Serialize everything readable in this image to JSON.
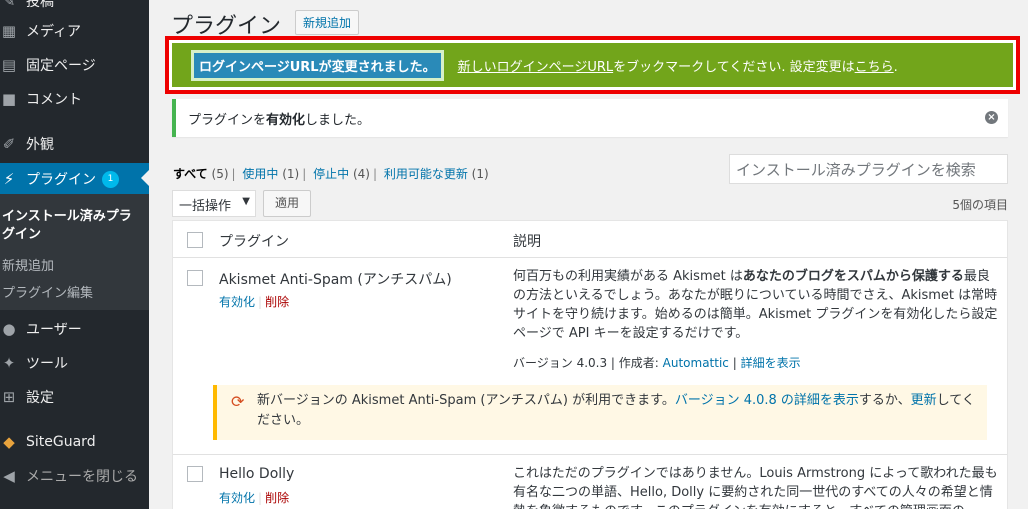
{
  "sidebar": {
    "items": [
      {
        "label": "投稿",
        "icon": "pin-icon"
      },
      {
        "label": "メディア",
        "icon": "media-icon"
      },
      {
        "label": "固定ページ",
        "icon": "page-icon"
      },
      {
        "label": "コメント",
        "icon": "comment-icon"
      },
      {
        "label": "外観",
        "icon": "brush-icon"
      },
      {
        "label": "プラグイン",
        "icon": "plug-icon",
        "badge": "1"
      },
      {
        "label": "ユーザー",
        "icon": "user-icon"
      },
      {
        "label": "ツール",
        "icon": "wrench-icon"
      },
      {
        "label": "設定",
        "icon": "settings-icon"
      },
      {
        "label": "SiteGuard",
        "icon": "siteguard-icon"
      },
      {
        "label": "メニューを閉じる",
        "icon": "collapse-icon"
      }
    ],
    "submenu": {
      "current": "インストール済みプラグイン",
      "items": [
        "新規追加",
        "プラグイン編集"
      ]
    }
  },
  "header": {
    "title": "プラグイン",
    "add_new": "新規追加"
  },
  "notice_url": {
    "button": "ログインページURLが変更されました。",
    "text_link1": "新しいログインページURL",
    "text_mid": "をブックマークしてください. 設定変更は",
    "text_link2": "こちら",
    "text_end": "."
  },
  "notice_activated": {
    "pre": "プラグインを",
    "bold": "有効化",
    "post": "しました。"
  },
  "filters": {
    "all": "すべて",
    "all_count": "(5)",
    "active": "使用中",
    "active_count": "(1)",
    "inactive": "停止中",
    "inactive_count": "(4)",
    "update": "利用可能な更新",
    "update_count": "(1)"
  },
  "search": {
    "placeholder": "インストール済みプラグインを検索"
  },
  "bulk": {
    "label": "一括操作",
    "apply": "適用",
    "item_count": "5個の項目"
  },
  "table": {
    "col_plugin": "プラグイン",
    "col_desc": "説明",
    "rows": [
      {
        "name": "Akismet Anti-Spam (アンチスパム)",
        "activate": "有効化",
        "delete": "削除",
        "desc_pre": "何百万もの利用実績がある Akismet は",
        "desc_bold": "あなたのブログをスパムから保護する",
        "desc_post": "最良の方法といえるでしょう。あなたが眠りについている時間でさえ、Akismet は常時サイトを守り続けます。始めるのは簡単。Akismet プラグインを有効化したら設定ページで API キーを設定するだけです。",
        "version": "バージョン 4.0.3",
        "author_label": "作成者:",
        "author": "Automattic",
        "details": "詳細を表示",
        "update_pre": "新バージョンの Akismet Anti-Spam (アンチスパム) が利用できます。",
        "update_link": "バージョン 4.0.8 の詳細を表示",
        "update_mid": "するか、",
        "update_link2": "更新",
        "update_post": "してください。"
      },
      {
        "name": "Hello Dolly",
        "activate": "有効化",
        "delete": "削除",
        "desc": "これはただのプラグインではありません。Louis Armstrong によって歌われた最も有名な二つの単語、Hello, Dolly に要約された同一世代のすべての人々の希望と情熱を象徴するものです。このプラグインを有効にすると、すべての管理画面の"
      }
    ]
  }
}
